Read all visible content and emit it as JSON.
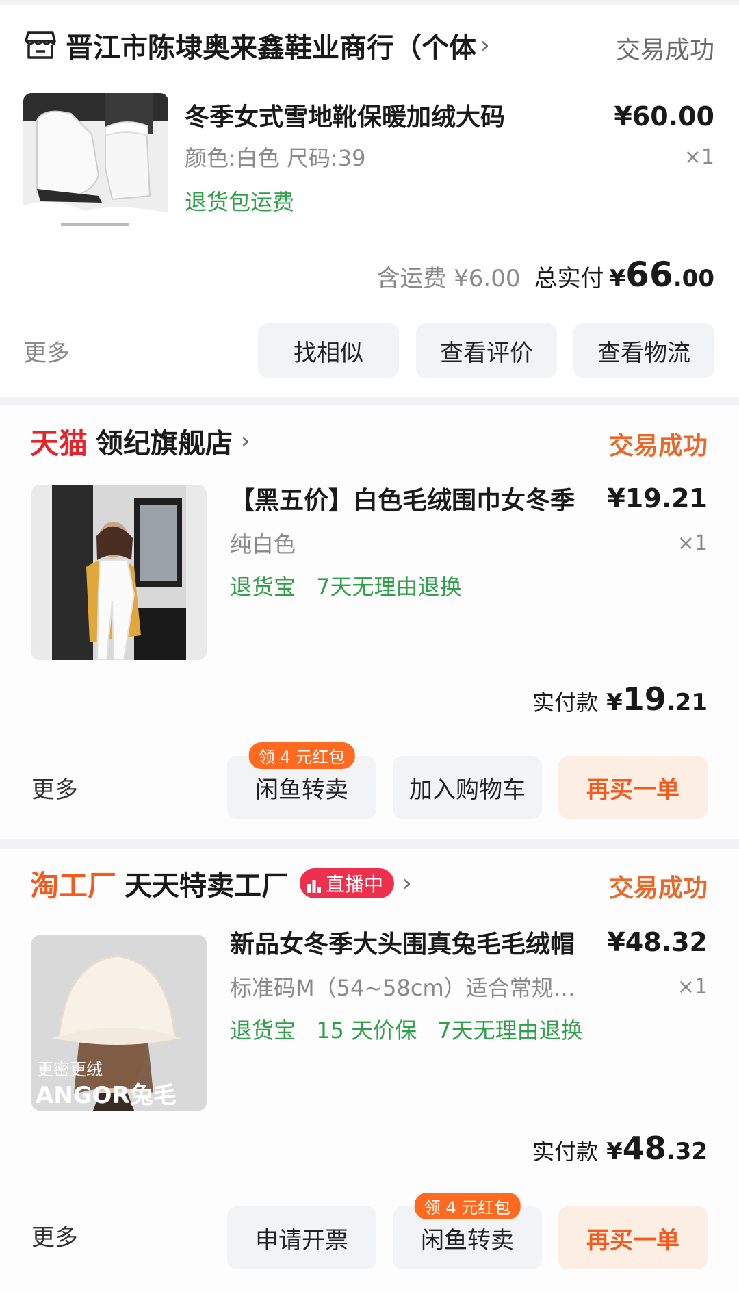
{
  "orders": [
    {
      "shop": {
        "name": "晋江市陈埭奥来鑫鞋业商行（个体"
      },
      "status": "交易成功",
      "item": {
        "title": "冬季女式雪地靴保暖加绒大码",
        "spec": "颜色:白色 尺码:39",
        "tag": "退货包运费",
        "price": "¥60.00",
        "qty": "×1"
      },
      "summary": {
        "shipping": "含运费 ¥6.00",
        "total_label": "总实付",
        "total_symbol": "¥",
        "total_int": "66",
        "total_dec": ".00"
      },
      "actions": {
        "more": "更多",
        "b1": "找相似",
        "b2": "查看评价",
        "b3": "查看物流"
      }
    },
    {
      "shop": {
        "brand": "天猫",
        "name": "领纪旗舰店"
      },
      "status": "交易成功",
      "item": {
        "title": "【黑五价】白色毛绒围巾女冬季",
        "spec": "纯白色",
        "tag1": "退货宝",
        "tag2": "7天无理由退换",
        "price": "¥19.21",
        "qty": "×1"
      },
      "summary": {
        "label": "实付款",
        "symbol": "¥",
        "int": "19",
        "dec": ".21"
      },
      "actions": {
        "more": "更多",
        "b1": "闲鱼转卖",
        "b1_badge": "领 4 元红包",
        "b2": "加入购物车",
        "b3": "再买一单"
      }
    },
    {
      "shop": {
        "brand": "淘工厂",
        "name": "天天特卖工厂",
        "live": "直播中"
      },
      "status": "交易成功",
      "item": {
        "title": "新品女冬季大头围真兔毛毛绒帽",
        "spec": "标准码M（54~58cm）适合常规…",
        "tag1": "退货宝",
        "tag2": "15 天价保",
        "tag3": "7天无理由退换",
        "price": "¥48.32",
        "qty": "×1",
        "img_text1": "更密更绒",
        "img_text2": "ANGOR兔毛"
      },
      "summary": {
        "label": "实付款",
        "symbol": "¥",
        "int": "48",
        "dec": ".32"
      },
      "actions": {
        "more": "更多",
        "b1": "申请开票",
        "b2": "闲鱼转卖",
        "b2_badge": "领 4 元红包",
        "b3": "再买一单"
      }
    }
  ],
  "colors": {
    "accent": "#f25a1e",
    "green": "#2fa04a",
    "tmall": "#e3242b",
    "status_orange": "#e8692a"
  },
  "icons": [
    "store-icon",
    "chevron-right-icon",
    "live-bars-icon"
  ]
}
